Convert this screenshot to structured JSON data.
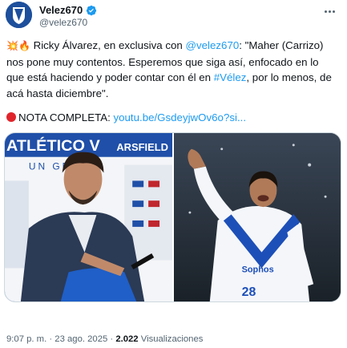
{
  "user": {
    "display_name": "Velez670",
    "handle": "@velez670",
    "avatar_icon": "velez-shield-logo",
    "verified_icon": "verified-badge-icon",
    "verified_color": "#1d9bf0"
  },
  "tweet": {
    "emojis": "💥🔥",
    "text_part1": " Ricky Álvarez, en exclusiva con ",
    "mention": "@velez670",
    "text_part2": ": \"Maher (Carrizo) nos pone muy contentos. Esperemos que siga así, enfocado en lo que está haciendo y poder contar con él en ",
    "hashtag": "#Vélez",
    "text_part3": ", por lo menos, de acá hasta diciembre\".",
    "nota_label": "NOTA COMPLETA: ",
    "nota_link": "youtu.be/GsdeyjwOv6o?si..."
  },
  "media": {
    "left_photo": "man-signing-shirt-photo",
    "left_wall_text": "ATLÉTICO V",
    "left_wall_text2": "ARSFIELD",
    "left_wall_text3": "UN GR",
    "right_photo": "player-celebrating-photo",
    "right_shirt_text": "Sophos",
    "right_shirt_number": "28"
  },
  "meta": {
    "time": "9:07 p. m.",
    "sep1": " · ",
    "date": "23 ago. 2025",
    "sep2": " · ",
    "views_count": "2.022",
    "views_label": " Visualizaciones"
  },
  "colors": {
    "link": "#1d9bf0",
    "text": "#0f1419",
    "muted": "#536471",
    "brand_blue": "#1d4f9c"
  }
}
